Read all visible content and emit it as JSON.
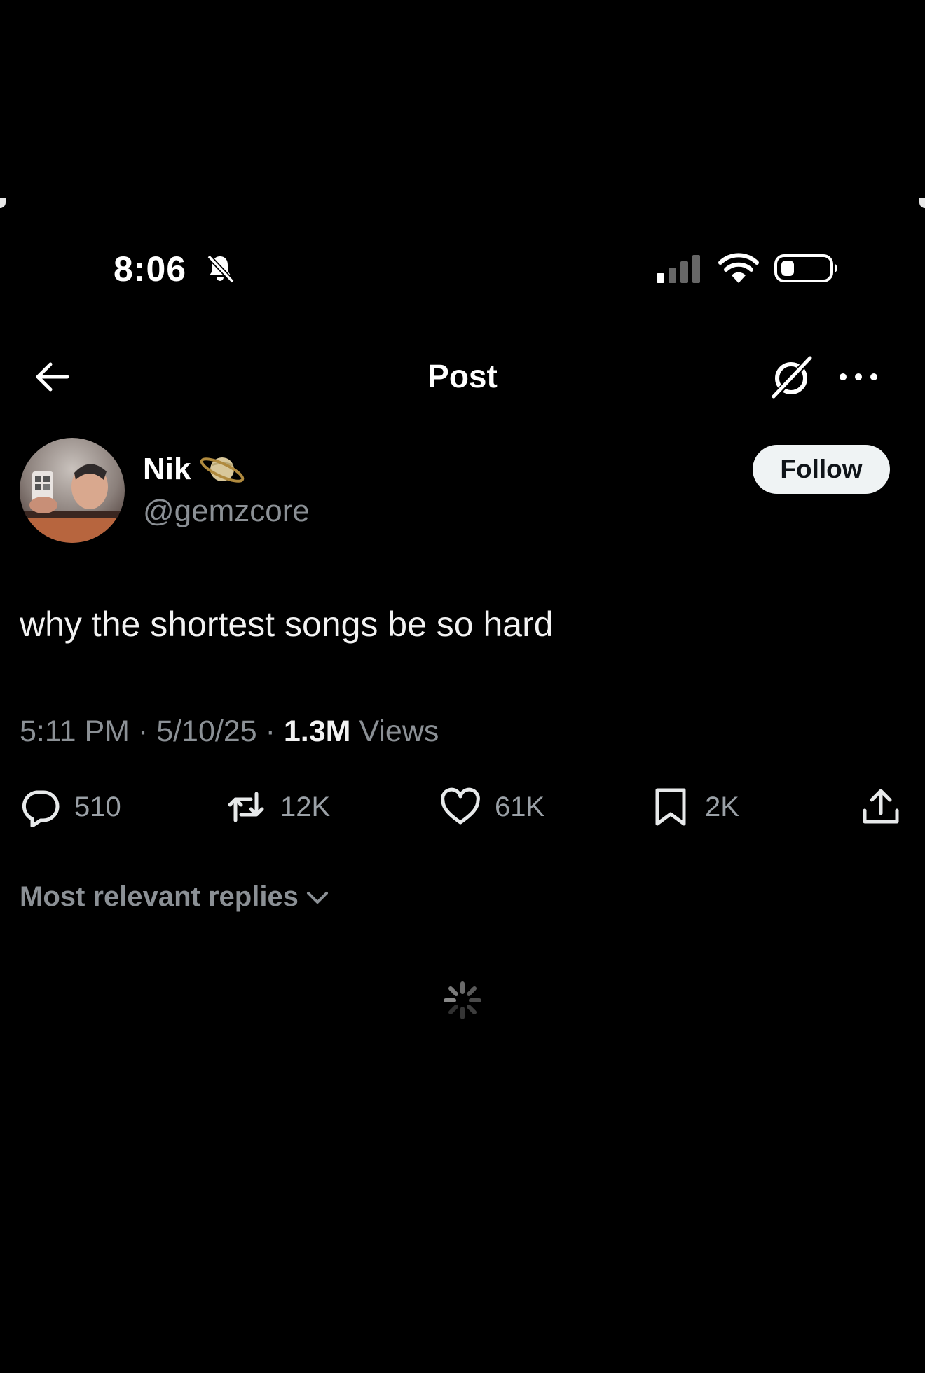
{
  "status_bar": {
    "time": "8:06"
  },
  "header": {
    "title": "Post"
  },
  "author": {
    "name": "Nik",
    "handle": "@gemzcore",
    "follow_label": "Follow"
  },
  "post": {
    "text": "why the shortest songs be so hard",
    "time": "5:11 PM",
    "date": "5/10/25",
    "views_count": "1.3M",
    "views_label": "Views"
  },
  "actions": {
    "replies": "510",
    "reposts": "12K",
    "likes": "61K",
    "bookmarks": "2K"
  },
  "replies_sort": {
    "label": "Most relevant replies"
  },
  "icons": [
    "back-arrow-icon",
    "grok-icon",
    "more-icon",
    "bell-slash-icon",
    "signal-icon",
    "wifi-icon",
    "battery-icon",
    "planet-emoji-icon",
    "reply-icon",
    "repost-icon",
    "like-icon",
    "bookmark-icon",
    "share-icon",
    "chevron-down-icon",
    "loading-spinner-icon"
  ],
  "colors": {
    "background": "#000000",
    "text": "#e7e9ea",
    "secondary": "#8b9095",
    "follow_bg": "#eff3f4"
  }
}
